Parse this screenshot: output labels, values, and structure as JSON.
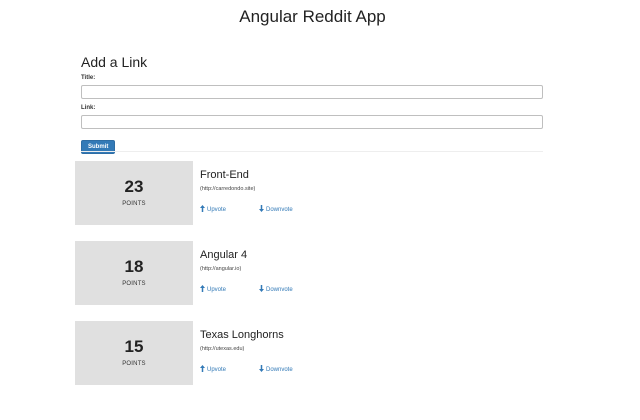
{
  "header": {
    "title": "Angular Reddit App"
  },
  "form": {
    "heading": "Add a Link",
    "title_label": "Title:",
    "title_value": "",
    "link_label": "Link:",
    "link_value": "",
    "submit_label": "Submit"
  },
  "colors": {
    "accent": "#337ab7",
    "votes_box": "#e0e0e0"
  },
  "articles": [
    {
      "votes": "23",
      "points_label": "POINTS",
      "title": "Front-End",
      "domain": "(http://carredondo.site)",
      "upvote_label": "Upvote",
      "downvote_label": "Downvote",
      "upvote_icon": "arrow-up-icon",
      "downvote_icon": "arrow-down-icon"
    },
    {
      "votes": "18",
      "points_label": "POINTS",
      "title": "Angular 4",
      "domain": "(http://angular.io)",
      "upvote_label": "Upvote",
      "downvote_label": "Downvote",
      "upvote_icon": "arrow-up-icon",
      "downvote_icon": "arrow-down-icon"
    },
    {
      "votes": "15",
      "points_label": "POINTS",
      "title": "Texas Longhorns",
      "domain": "(http://utexas.edu)",
      "upvote_label": "Upvote",
      "downvote_label": "Downvote",
      "upvote_icon": "arrow-up-icon",
      "downvote_icon": "arrow-down-icon"
    }
  ]
}
